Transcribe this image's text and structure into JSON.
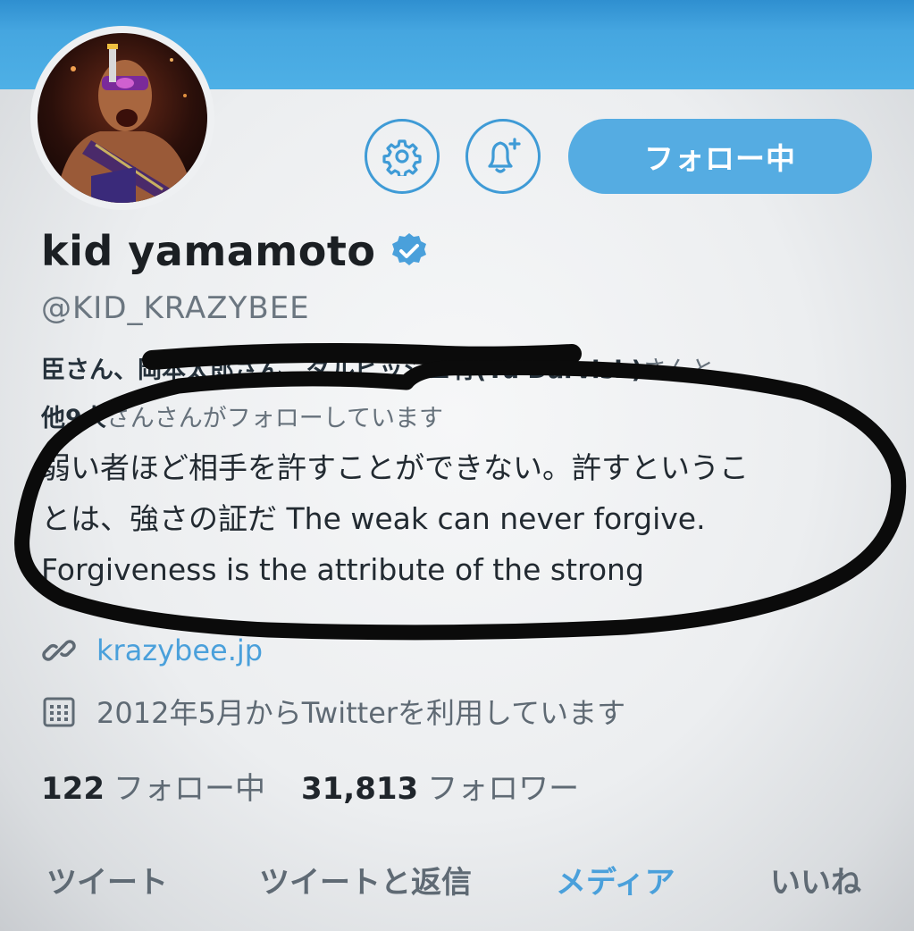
{
  "header": {
    "follow_button_label": "フォロー中",
    "accent_color": "#4aa0db"
  },
  "profile": {
    "display_name": "kid yamamoto",
    "handle": "@KID_KRAZYBEE",
    "followed_by_line1_start": "臣さん、",
    "followed_by_line1_obscured": "岡本太郎さん、",
    "followed_by_line1_bold": "ダルビッシュ有(Yu Darvish)",
    "followed_by_line1_end": "さんと",
    "followed_by_line2_bold": "他9人",
    "followed_by_line2_end": "さんさんがフォローしています",
    "bio_line1": "弱い者ほど相手を許すことができない。許すというこ",
    "bio_line2": "とは、強さの証だ The weak can never forgive.",
    "bio_line3": "Forgiveness is the attribute of the strong",
    "website": "krazybee.jp",
    "joined": "2012年5月からTwitterを利用しています"
  },
  "stats": {
    "following_count": "122",
    "following_label": "フォロー中",
    "followers_count": "31,813",
    "followers_label": "フォロワー"
  },
  "tabs": [
    {
      "label": "ツイート"
    },
    {
      "label": "ツイートと返信"
    },
    {
      "label": "メディア"
    },
    {
      "label": "いいね"
    }
  ],
  "icons": [
    "gear-icon",
    "bell-plus-icon",
    "verified-badge-icon",
    "link-icon",
    "calendar-icon"
  ]
}
